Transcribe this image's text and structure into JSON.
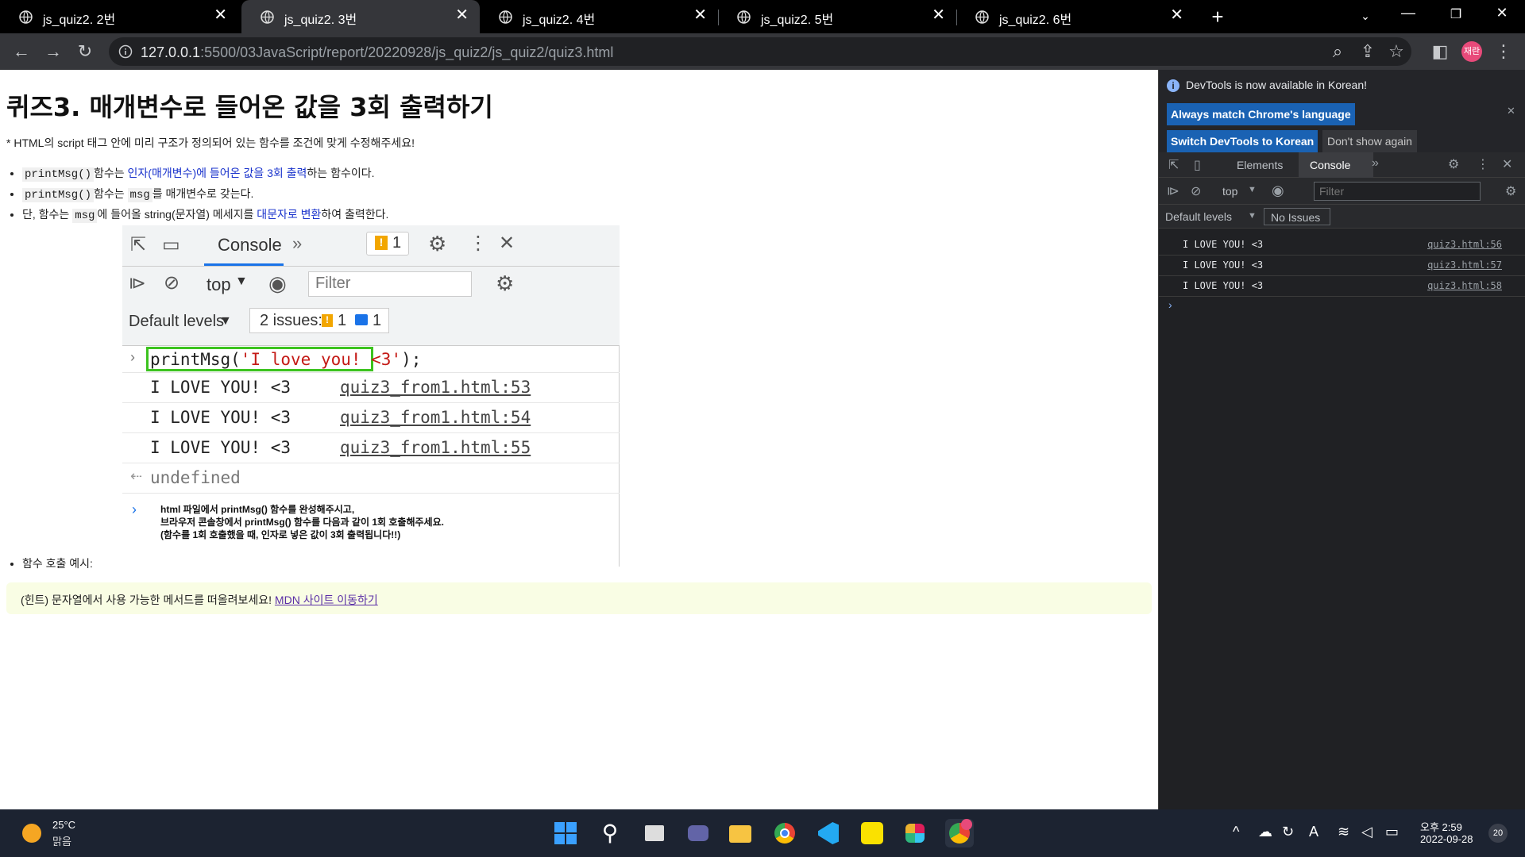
{
  "browser": {
    "tabs": [
      {
        "title": "js_quiz2. 2번",
        "active": false
      },
      {
        "title": "js_quiz2. 3번",
        "active": true
      },
      {
        "title": "js_quiz2. 4번",
        "active": false
      },
      {
        "title": "js_quiz2. 5번",
        "active": false
      },
      {
        "title": "js_quiz2. 6번",
        "active": false
      }
    ],
    "new_tab": "+",
    "url_host": "127.0.0.1",
    "url_path": ":5500/03JavaScript/report/20220928/js_quiz2/js_quiz2/quiz3.html",
    "profile_initials": "재란"
  },
  "page": {
    "title": "퀴즈3. 매개변수로 들어온 값을 3회 출력하기",
    "intro": "* HTML의 script 태그 안에 미리 구조가 정의되어 있는 함수를 조건에 맞게 수정해주세요!",
    "req1_code": "printMsg()",
    "req1_a": "함수는 ",
    "req1_b": "인자(매개변수)에 들어온 값을 3회 출력",
    "req1_c": "하는 함수이다.",
    "req2_code": "printMsg()",
    "req2_a": "함수는 ",
    "req2_code2": "msg",
    "req2_b": "를 매개변수로 갖는다.",
    "req3_a": "단, 함수는 ",
    "req3_code": "msg",
    "req3_b": "에 들어올 string(문자열) 메세지를 ",
    "req3_c": "대문자로 변환",
    "req3_d": "하여 출력한다.",
    "example_label": "함수 호출 예시:",
    "hint_text": "(힌트) 문자열에서 사용 가능한 메서드를 떠올려보세요! ",
    "hint_link": "MDN 사이트 이동하기",
    "embedded": {
      "tab_label": "Console",
      "warn_count": "1",
      "context": "top",
      "filter_placeholder": "Filter",
      "levels": "Default levels",
      "issues_label": "2 issues:",
      "issues_warn": "1",
      "issues_info": "1",
      "command": "printMsg('I love you! <3');",
      "command_fn": "printMsg(",
      "command_arg": "'I love you! <3'",
      "command_end": ");",
      "outputs": [
        {
          "msg": "I LOVE YOU! <3",
          "src": "quiz3_from1.html:53"
        },
        {
          "msg": "I LOVE YOU! <3",
          "src": "quiz3_from1.html:54"
        },
        {
          "msg": "I LOVE YOU! <3",
          "src": "quiz3_from1.html:55"
        }
      ],
      "return_value": "undefined",
      "note_line1": "html 파일에서 printMsg() 함수를 완성해주시고,",
      "note_line2": "브라우저 콘솔창에서 printMsg() 함수를 다음과 같이 1회 호출해주세요.",
      "note_line3": "(함수를 1회 호출했을 때, 인자로 넣은 값이 3회 출력됩니다!!)"
    }
  },
  "devtools": {
    "banner": "DevTools is now available in Korean!",
    "btn_match": "Always match Chrome's language",
    "btn_switch": "Switch DevTools to Korean",
    "btn_dont": "Don't show again",
    "tab_elements": "Elements",
    "tab_console": "Console",
    "context": "top",
    "filter_placeholder": "Filter",
    "levels": "Default levels",
    "no_issues": "No Issues",
    "logs": [
      {
        "msg": "I LOVE YOU! <3",
        "src": "quiz3.html:56"
      },
      {
        "msg": "I LOVE YOU! <3",
        "src": "quiz3.html:57"
      },
      {
        "msg": "I LOVE YOU! <3",
        "src": "quiz3.html:58"
      }
    ]
  },
  "taskbar": {
    "temperature": "25°C",
    "weather": "맑음",
    "time": "오후 2:59",
    "date": "2022-09-28",
    "notification_count": "20"
  },
  "colors": {
    "accent_blue": "#1a62b3",
    "highlight_green": "#3cc31f",
    "link_blue": "#1a33cc"
  }
}
